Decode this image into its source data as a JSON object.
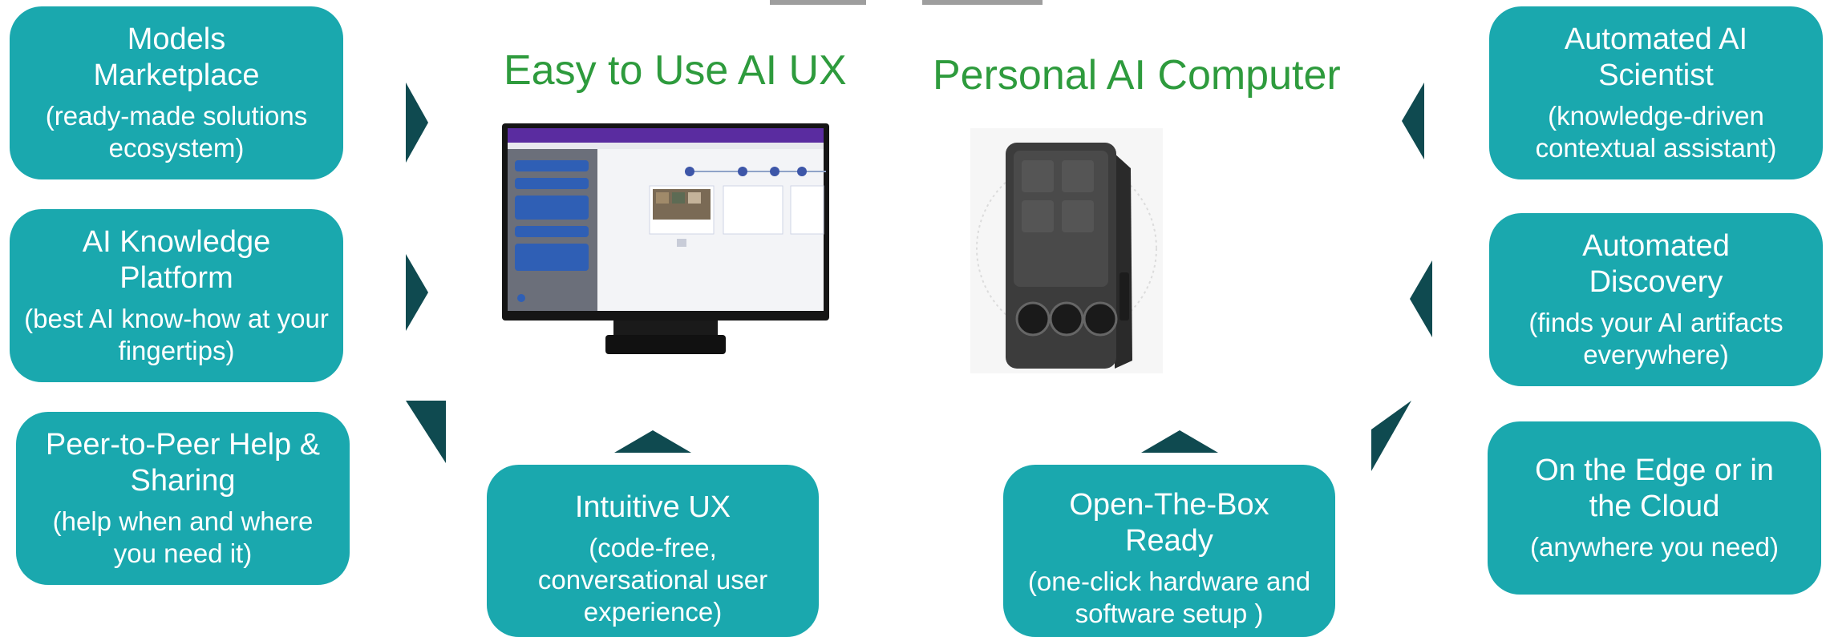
{
  "headings": {
    "ux": "Easy to Use AI UX",
    "computer": "Personal AI Computer"
  },
  "boxes": {
    "models": {
      "title": "Models Marketplace",
      "sub": "(ready-made solutions ecosystem)"
    },
    "knowledge": {
      "title": "AI Knowledge Platform",
      "sub": "(best AI know-how at your fingertips)"
    },
    "peer": {
      "title": "Peer-to-Peer Help & Sharing",
      "sub": "(help when and where you need it)"
    },
    "intuitive": {
      "title": "Intuitive UX",
      "sub": "(code-free, conversational user experience)"
    },
    "openbox": {
      "title": "Open-The-Box Ready",
      "sub": "(one-click hardware and software setup )"
    },
    "scientist": {
      "title": "Automated AI Scientist",
      "sub": "(knowledge-driven contextual assistant)"
    },
    "discovery": {
      "title": "Automated Discovery",
      "sub": "(finds your AI artifacts everywhere)"
    },
    "edge": {
      "title": "On the Edge or in the Cloud",
      "sub": "(anywhere you need)"
    }
  },
  "colors": {
    "box": "#1aa8ae",
    "heading": "#2e9b3d",
    "arrow": "#0f4a50"
  }
}
